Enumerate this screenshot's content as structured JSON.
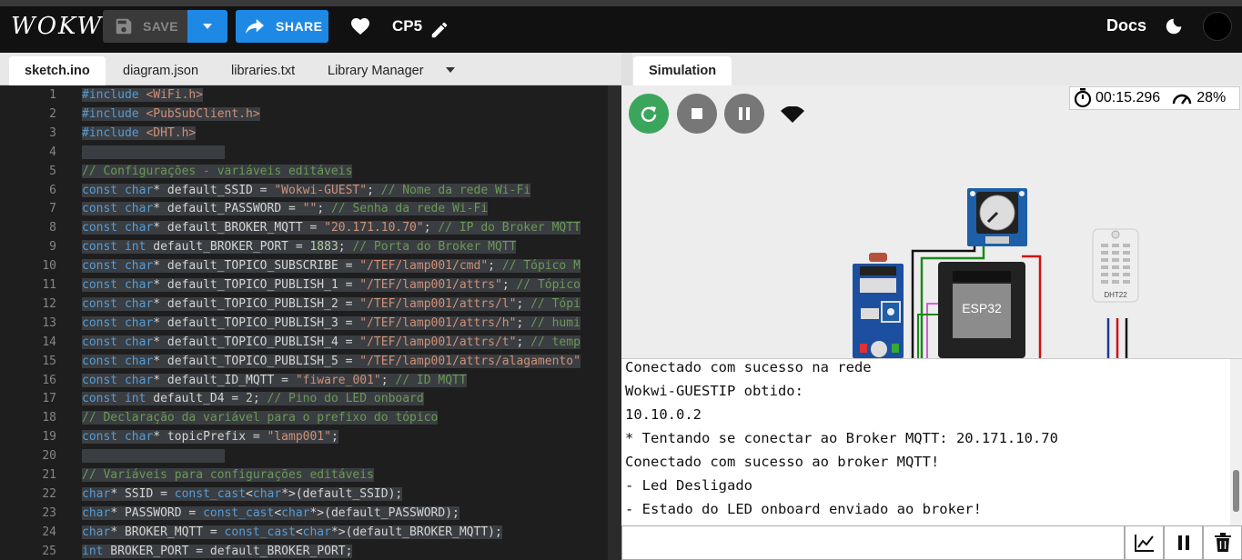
{
  "app": {
    "logo": "WOKWi",
    "save_label": "SAVE",
    "share_label": "SHARE",
    "project_title": "CP5",
    "docs_label": "Docs"
  },
  "editor": {
    "tabs": [
      "sketch.ino",
      "diagram.json",
      "libraries.txt",
      "Library Manager"
    ],
    "active_tab": "sketch.ino"
  },
  "simulation": {
    "tab_label": "Simulation",
    "timer": "00:15.296",
    "speed": "28%",
    "esp_label": "ESP32",
    "dht_label": "DHT22"
  },
  "serial": {
    "lines": [
      "Conectado com sucesso na rede",
      "Wokwi-GUESTIP obtido:",
      "10.10.0.2",
      "* Tentando se conectar ao Broker MQTT: 20.171.10.70",
      "Conectado com sucesso ao broker MQTT!",
      "- Led Desligado",
      "- Estado do LED onboard enviado ao broker!"
    ]
  },
  "colors": {
    "accent": "#1e88e5",
    "restart": "#3ba55c",
    "editor_bg": "#1e1e1e"
  },
  "code": [
    "#include <WiFi.h>",
    "#include <PubSubClient.h>",
    "#include <DHT.h>",
    "",
    "// Configurações - variáveis editáveis",
    "const char* default_SSID = \"Wokwi-GUEST\"; // Nome da rede Wi-Fi",
    "const char* default_PASSWORD = \"\"; // Senha da rede Wi-Fi",
    "const char* default_BROKER_MQTT = \"20.171.10.70\"; // IP do Broker MQTT",
    "const int default_BROKER_PORT = 1883; // Porta do Broker MQTT",
    "const char* default_TOPICO_SUBSCRIBE = \"/TEF/lamp001/cmd\"; // Tópico M",
    "const char* default_TOPICO_PUBLISH_1 = \"/TEF/lamp001/attrs\"; // Tópico",
    "const char* default_TOPICO_PUBLISH_2 = \"/TEF/lamp001/attrs/l\"; // Tópi",
    "const char* default_TOPICO_PUBLISH_3 = \"/TEF/lamp001/attrs/h\"; // humi",
    "const char* default_TOPICO_PUBLISH_4 = \"/TEF/lamp001/attrs/t\"; // temp",
    "const char* default_TOPICO_PUBLISH_5 = \"/TEF/lamp001/attrs/alagamento\"",
    "const char* default_ID_MQTT = \"fiware_001\"; // ID MQTT",
    "const int default_D4 = 2; // Pino do LED onboard",
    "// Declaração da variável para o prefixo do tópico",
    "const char* topicPrefix = \"lamp001\";",
    "",
    "// Variáveis para configurações editáveis",
    "char* SSID = const_cast<char*>(default_SSID);",
    "char* PASSWORD = const_cast<char*>(default_PASSWORD);",
    "char* BROKER_MQTT = const_cast<char*>(default_BROKER_MQTT);",
    "int BROKER_PORT = default_BROKER_PORT;"
  ]
}
